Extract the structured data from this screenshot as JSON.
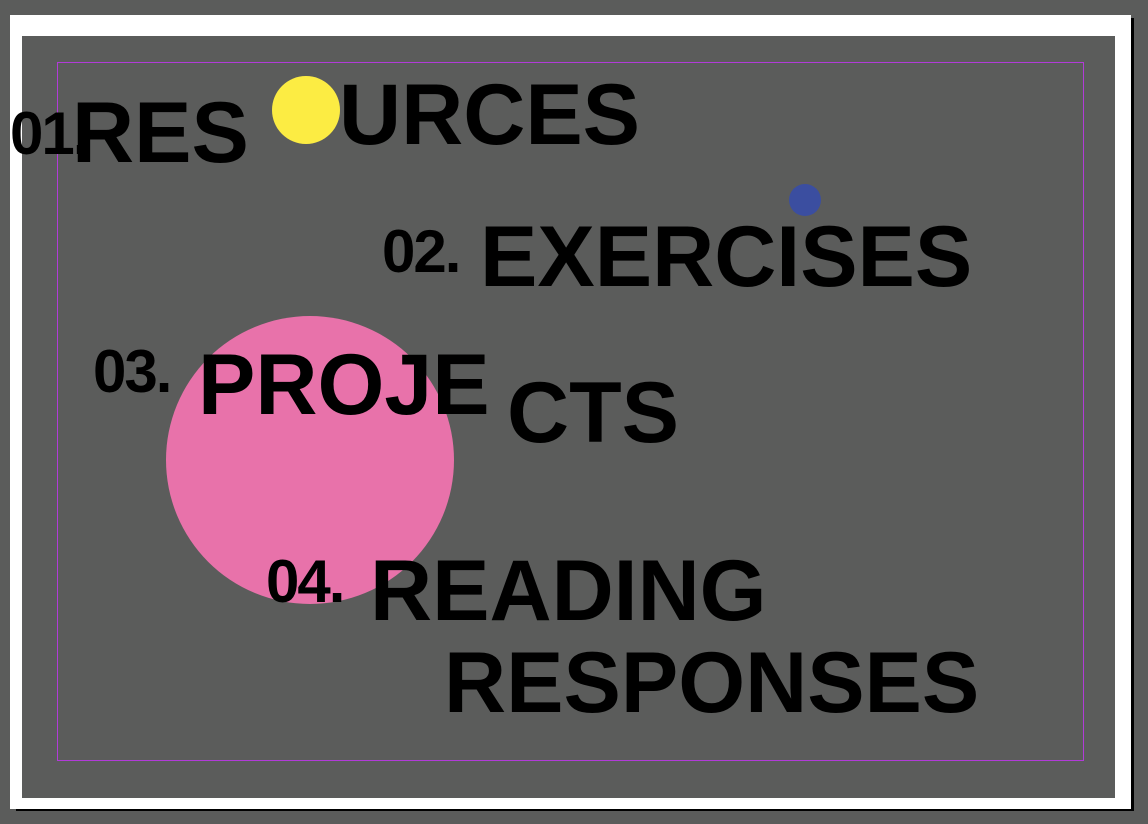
{
  "colors": {
    "pasteboard": "#5b5c5b",
    "page": "#ffffff",
    "margin_guide": "#b23bd9",
    "yellow_dot": "#fcec43",
    "blue_dot": "#3b4ea0",
    "pink_circle": "#e872aa",
    "text": "#000000"
  },
  "items": [
    {
      "number": "01.",
      "title_part1": "RES",
      "title_part2": "URCES"
    },
    {
      "number": "02.",
      "title": "EXERCISES"
    },
    {
      "number": "03.",
      "title_part1": "PROJE",
      "title_part2": "CTS"
    },
    {
      "number": "04.",
      "title_line1": "READING",
      "title_line2": "RESPONSES"
    }
  ]
}
